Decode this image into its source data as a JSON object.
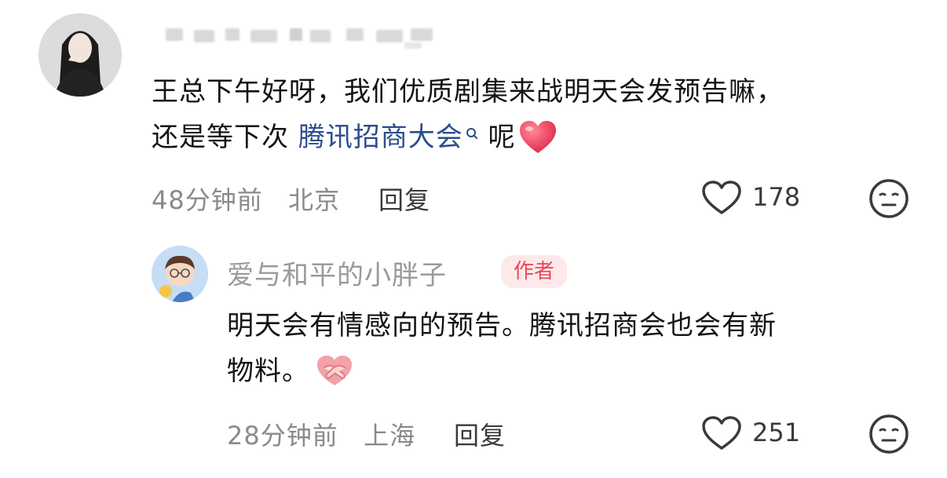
{
  "comment": {
    "text_line1": "王总下午好呀，我们优质剧集来战明天会发预告嘛，",
    "text_line2_prefix": "还是等下次 ",
    "link_text": "腾讯招商大会",
    "text_line2_suffix": " 呢",
    "timestamp": "48分钟前",
    "location": "北京",
    "reply_label": "回复",
    "like_count": "178"
  },
  "reply": {
    "username": "爱与和平的小胖子",
    "badge": "作者",
    "text_line1": "明天会有情感向的预告。腾讯招商会也会有新",
    "text_line2": "物料。",
    "timestamp": "28分钟前",
    "location": "上海",
    "reply_label": "回复",
    "like_count": "251"
  },
  "colors": {
    "link": "#2b4c8c",
    "badge_bg": "#fde9ea",
    "badge_text": "#e8475a",
    "heart_emoji": "#f0506a"
  },
  "icons": [
    "search-icon",
    "heart-emoji-icon",
    "like-heart-icon",
    "dislike-face-icon",
    "handshake-emoji-icon"
  ]
}
